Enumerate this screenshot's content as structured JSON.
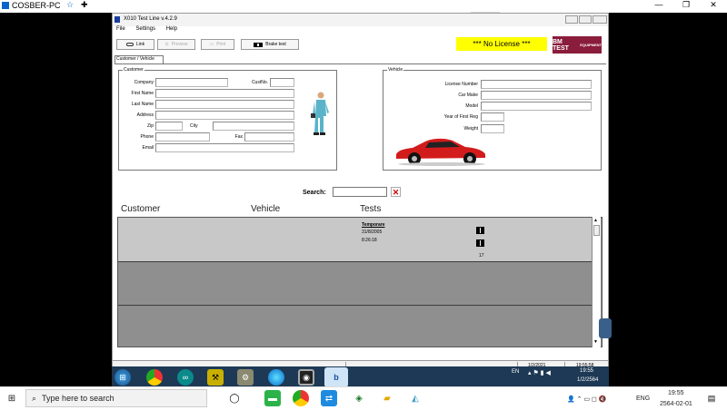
{
  "host": {
    "window_title": "COSBER-PC",
    "controls": [
      "—",
      "❐",
      "✕"
    ]
  },
  "app": {
    "title": "X010 Test Line v.4.2.9",
    "menu": [
      "File",
      "Settings",
      "Help"
    ],
    "toolbar": {
      "link": "Link",
      "preview": "Preview",
      "print": "Print",
      "brake_test": "Brake test"
    },
    "license_banner": "***  No License  ***",
    "logo_text": "BM TEST",
    "logo_sub": "EQUIPMENT",
    "tab": "Customer / Vehicle",
    "customer": {
      "group": "Customer",
      "company": "Company",
      "custno": "CustNo.",
      "first_name": "First Name",
      "last_name": "Last Name",
      "address": "Address",
      "zip": "Zip",
      "city": "City",
      "phone": "Phone",
      "fax": "Fax",
      "email": "Email"
    },
    "vehicle": {
      "group": "Vehicle",
      "license": "License Number",
      "make": "Car Make",
      "model": "Model",
      "year": "Year of First Reg",
      "weight": "Weight"
    },
    "search_label": "Search:",
    "columns": [
      "Customer",
      "Vehicle",
      "Tests"
    ],
    "row1": {
      "test_name": "Temporare",
      "date": "31/8/2005",
      "time": "8:26:18",
      "count": "17"
    },
    "status": {
      "date": "1/2/2021",
      "time": "19:55:58"
    }
  },
  "remote_taskbar": {
    "lang": "EN",
    "time": "19:55",
    "date": "1/2/2564"
  },
  "host_taskbar": {
    "search_placeholder": "Type here to search",
    "lang": "ENG",
    "time": "19:55",
    "date": "2564-02-01"
  }
}
